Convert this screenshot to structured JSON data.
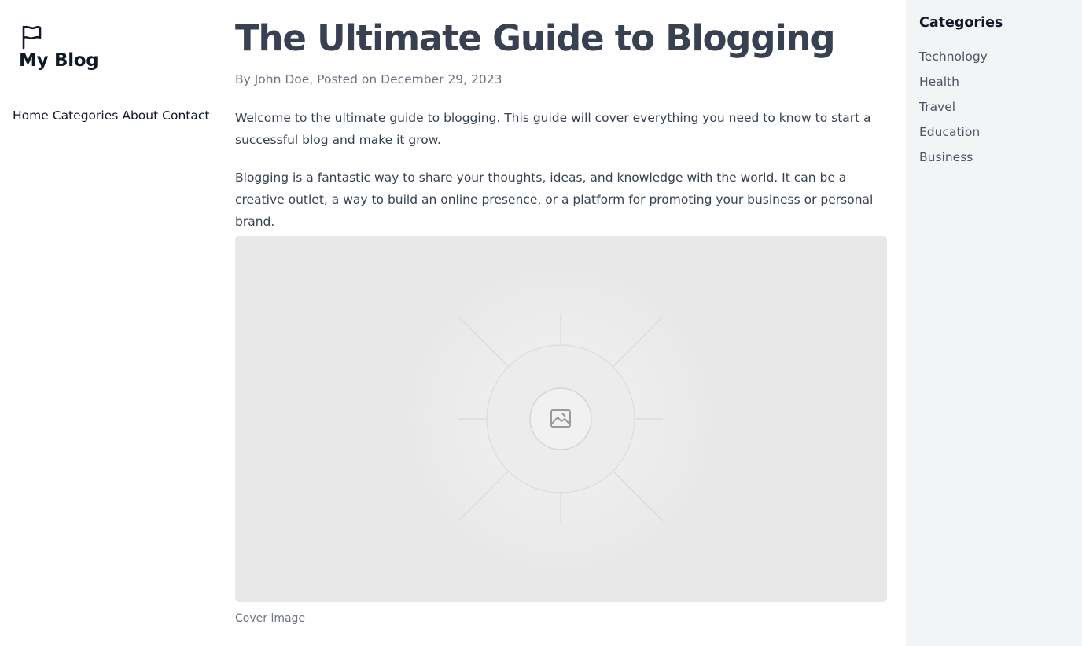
{
  "sidebar": {
    "logo_icon": "flag-icon",
    "brand": "My Blog",
    "nav": [
      "Home",
      "Categories",
      "About",
      "Contact"
    ]
  },
  "post": {
    "title": "The Ultimate Guide to Blogging",
    "byline": "By John Doe, Posted on December 29, 2023",
    "paragraphs": [
      "Welcome to the ultimate guide to blogging. This guide will cover everything you need to know to start a successful blog and make it grow.",
      "Blogging is a fantastic way to share your thoughts, ideas, and knowledge with the world. It can be a creative outlet, a way to build an online presence, or a platform for promoting your business or personal brand."
    ],
    "cover_icon": "image-icon",
    "caption": "Cover image"
  },
  "categories": {
    "title": "Categories",
    "items": [
      "Technology",
      "Health",
      "Travel",
      "Education",
      "Business"
    ]
  },
  "colors": {
    "heading": "#374151",
    "muted": "#6b7280",
    "sidebar_bg": "#f3f4f6",
    "cover_bg": "#e8e8e8"
  }
}
